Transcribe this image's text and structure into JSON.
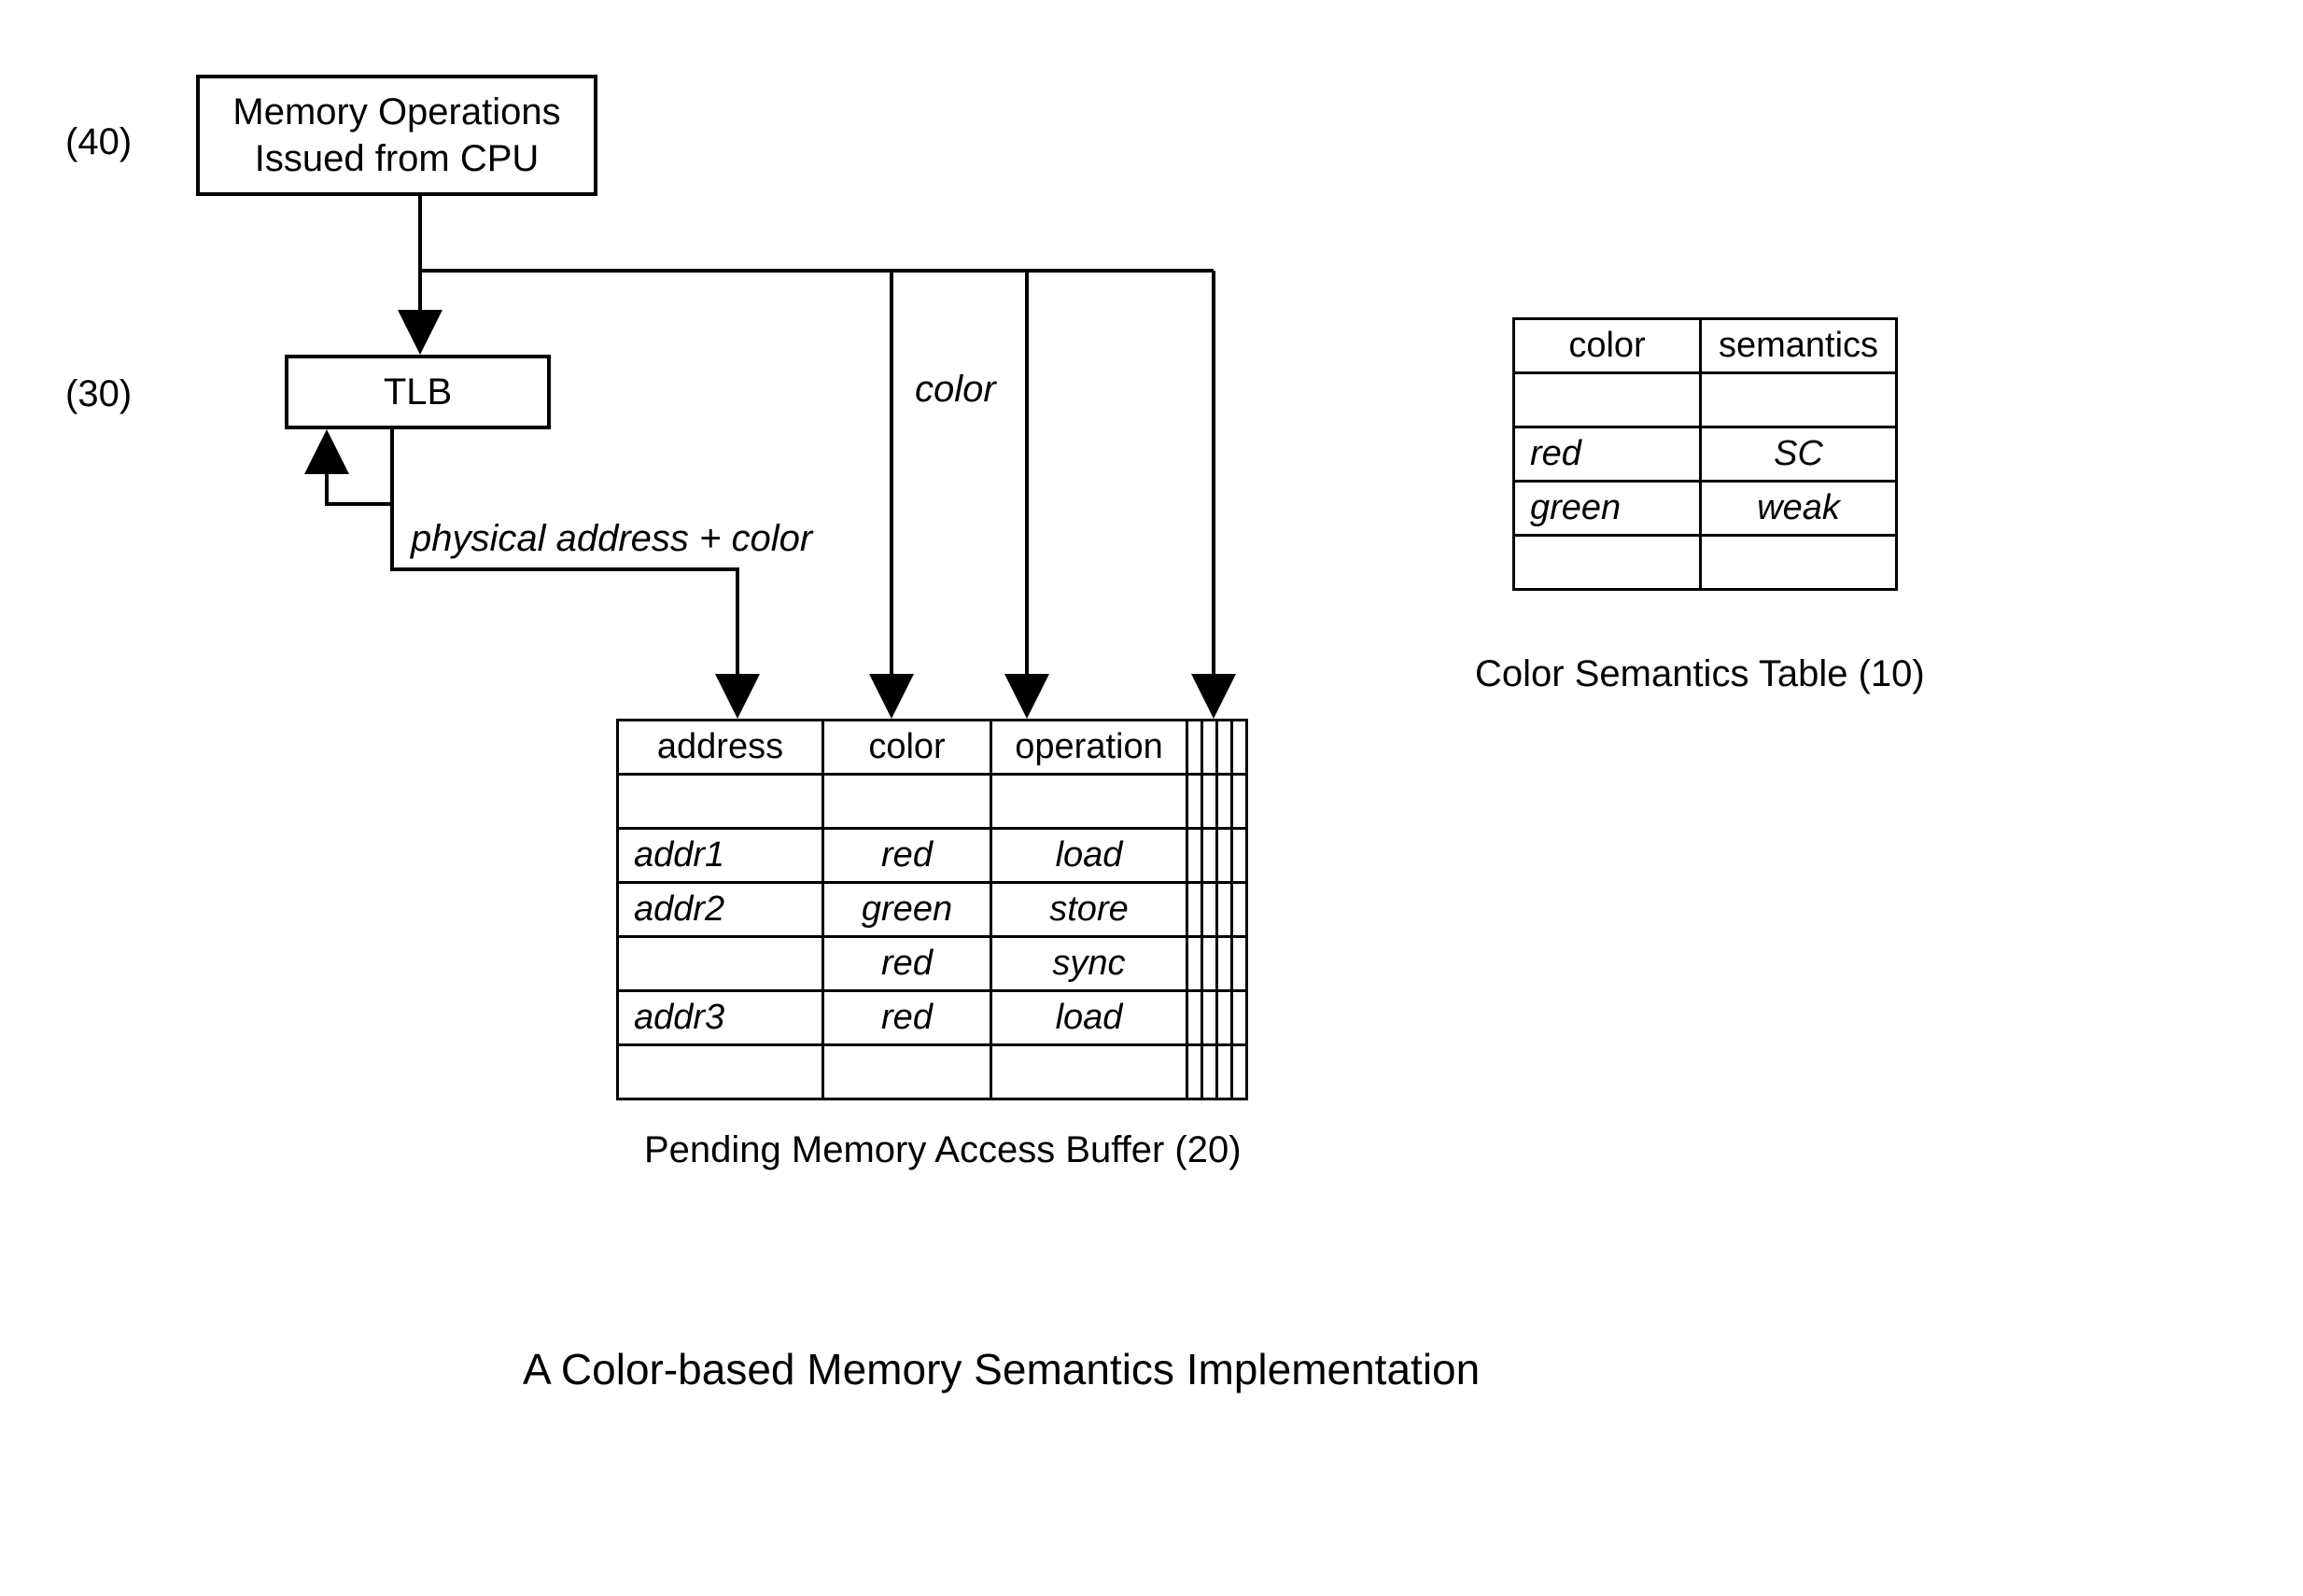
{
  "labels": {
    "n40": "(40)",
    "n30": "(30)",
    "cpu_line1": "Memory Operations",
    "cpu_line2": "Issued from CPU",
    "tlb": "TLB",
    "color_arrow": "color",
    "phys_addr": "physical address + color",
    "pmab_caption": "Pending Memory Access Buffer (20)",
    "cst_caption": "Color Semantics Table (10)",
    "title": "A Color-based Memory Semantics Implementation"
  },
  "pmab": {
    "headers": {
      "address": "address",
      "color": "color",
      "operation": "operation"
    },
    "rows": [
      {
        "address": "",
        "color": "",
        "operation": ""
      },
      {
        "address": "addr1",
        "color": "red",
        "operation": "load"
      },
      {
        "address": "addr2",
        "color": "green",
        "operation": "store"
      },
      {
        "address": "",
        "color": "red",
        "operation": "sync"
      },
      {
        "address": "addr3",
        "color": "red",
        "operation": "load"
      },
      {
        "address": "",
        "color": "",
        "operation": ""
      }
    ]
  },
  "cst": {
    "headers": {
      "color": "color",
      "semantics": "semantics"
    },
    "rows": [
      {
        "color": "",
        "semantics": ""
      },
      {
        "color": "red",
        "semantics": "SC"
      },
      {
        "color": "green",
        "semantics": "weak"
      },
      {
        "color": "",
        "semantics": ""
      }
    ]
  }
}
